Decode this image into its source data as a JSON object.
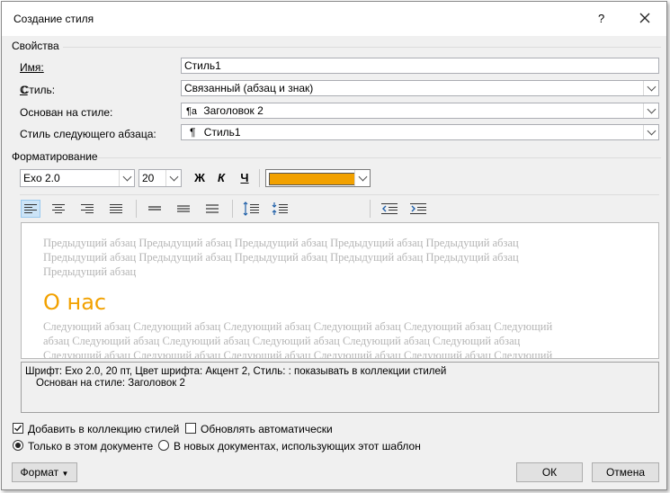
{
  "window": {
    "title": "Создание стиля",
    "help": "?",
    "close_icon": "close-icon"
  },
  "properties": {
    "section_label": "Свойства",
    "name_label": "Имя:",
    "name_value": "Стиль1",
    "style_label": "Стиль:",
    "style_value": "Связанный (абзац и знак)",
    "based_on_label": "Основан на стиле:",
    "based_on_icon": "¶a",
    "based_on_value": "Заголовок 2",
    "next_label": "Стиль следующего абзаца:",
    "next_icon": "¶",
    "next_value": "Стиль1"
  },
  "formatting": {
    "section_label": "Форматирование",
    "font": "Exo 2.0",
    "size": "20",
    "bold": "Ж",
    "italic": "К",
    "underline": "Ч",
    "color": "#f2a100"
  },
  "preview": {
    "prev_line1": "Предыдущий абзац Предыдущий абзац Предыдущий абзац Предыдущий абзац Предыдущий абзац",
    "prev_line2": "Предыдущий абзац Предыдущий абзац Предыдущий абзац Предыдущий абзац Предыдущий абзац",
    "prev_line3": "Предыдущий абзац",
    "heading": "О нас",
    "next_line1": "Следующий абзац Следующий абзац Следующий абзац Следующий абзац Следующий абзац Следующий",
    "next_line2": "абзац Следующий абзац Следующий абзац Следующий абзац Следующий абзац Следующий абзац",
    "next_line3": "Следующий абзац Следующий абзац Следующий абзац Следующий абзац Следующий абзац Следующий"
  },
  "description": {
    "line1": "Шрифт: Exo 2.0, 20 пт, Цвет шрифта: Акцент 2, Стиль: : показывать в коллекции стилей",
    "line2": "Основан на стиле: Заголовок 2"
  },
  "options": {
    "add_to_gallery": "Добавить в коллекцию стилей",
    "add_to_gallery_checked": true,
    "auto_update": "Обновлять автоматически",
    "auto_update_checked": false,
    "only_this_doc": "Только в этом документе",
    "new_docs": "В новых документах, использующих этот шаблон"
  },
  "buttons": {
    "format": "Формат",
    "ok": "ОК",
    "cancel": "Отмена"
  }
}
